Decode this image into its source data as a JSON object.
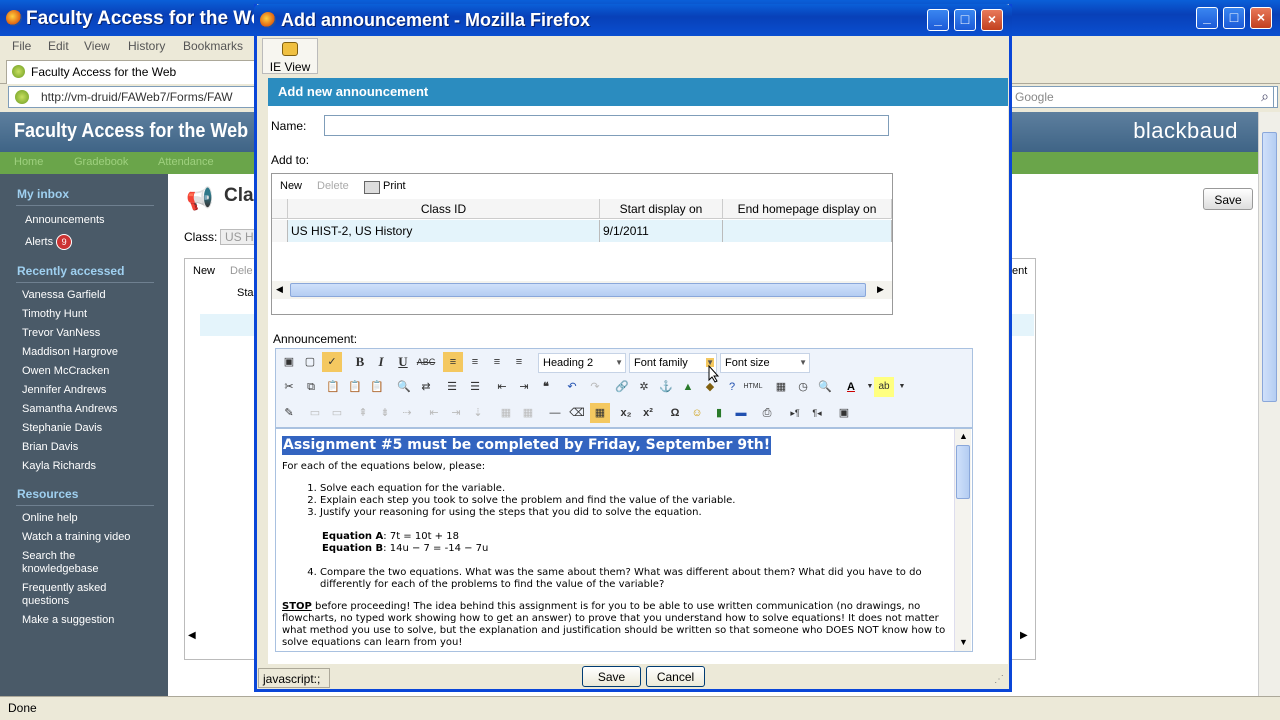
{
  "bg_window": {
    "title": "Faculty Access for the Web",
    "menu": [
      "File",
      "Edit",
      "View",
      "History",
      "Bookmarks"
    ],
    "tab": "Faculty Access for the Web",
    "url": "http://vm-druid/FAWeb7/Forms/FAW",
    "search_placeholder": "Google",
    "status": "Done"
  },
  "bg_page": {
    "banner": "Faculty Access for the Web",
    "brand": "blackbaud",
    "nav": [
      "Home",
      "Gradebook",
      "Attendance"
    ],
    "page_title": "Cla",
    "class_label": "Class:",
    "class_value": "US Hi",
    "save": "Save",
    "grid_new": "New",
    "grid_delete": "Dele",
    "grid_col": "Sta",
    "grid_col_right": "ent"
  },
  "sidebar": {
    "inbox_header": "My inbox",
    "announcements": "Announcements",
    "alerts": "Alerts",
    "alerts_count": "9",
    "recent_header": "Recently accessed",
    "recent": [
      "Vanessa Garfield",
      "Timothy Hunt",
      "Trevor VanNess",
      "Maddison Hargrove",
      "Owen McCracken",
      "Jennifer Andrews",
      "Samantha Andrews",
      "Stephanie Davis",
      "Brian Davis",
      "Kayla Richards"
    ],
    "resources_header": "Resources",
    "resources": [
      "Online help",
      "Watch a training video",
      "Search the knowledgebase",
      "Frequently asked questions",
      "Make a suggestion"
    ]
  },
  "popup": {
    "title": "Add announcement - Mozilla Firefox",
    "ie_view": "IE View",
    "header": "Add new announcement",
    "name_label": "Name:",
    "name_value": "",
    "add_to_label": "Add to:",
    "grid": {
      "new": "New",
      "delete": "Delete",
      "print": "Print",
      "columns": [
        "Class ID",
        "Start display on",
        "End homepage display on"
      ],
      "row": [
        "US HIST-2, US History",
        "9/1/2011",
        ""
      ]
    },
    "announcement_label": "Announcement:",
    "format_select": "Heading 2",
    "font_family": "Font family",
    "font_size": "Font size",
    "editor": {
      "heading": "Assignment #5 must be completed by Friday, September 9th!",
      "intro": "For each of the equations below, please:",
      "steps": [
        "Solve each equation for the variable.",
        "Explain each step you took to solve the problem and find the value of the variable.",
        "Justify your reasoning for using the steps that you did to solve the equation."
      ],
      "eqA_label": "Equation A",
      "eqA": ": 7t = 10t + 18",
      "eqB_label": "Equation B",
      "eqB": ": 14u − 7 = -14 − 7u",
      "step4": "Compare the two equations. What was the same about them? What was different about them? What did you have to do differently for each of the problems to find the value of the variable?",
      "stop_word": "STOP",
      "stop_text": " before proceeding! The idea behind this assignment is for you to be able to use written communication (no drawings, no flowcharts, no typed work showing how to get an answer) to prove that you understand how to solve equations! It does not matter what method you use to solve, but the explanation and justification should be written so that someone who DOES NOT know how to solve equations can learn from you!"
    },
    "save": "Save",
    "cancel": "Cancel",
    "status": "javascript:;"
  }
}
